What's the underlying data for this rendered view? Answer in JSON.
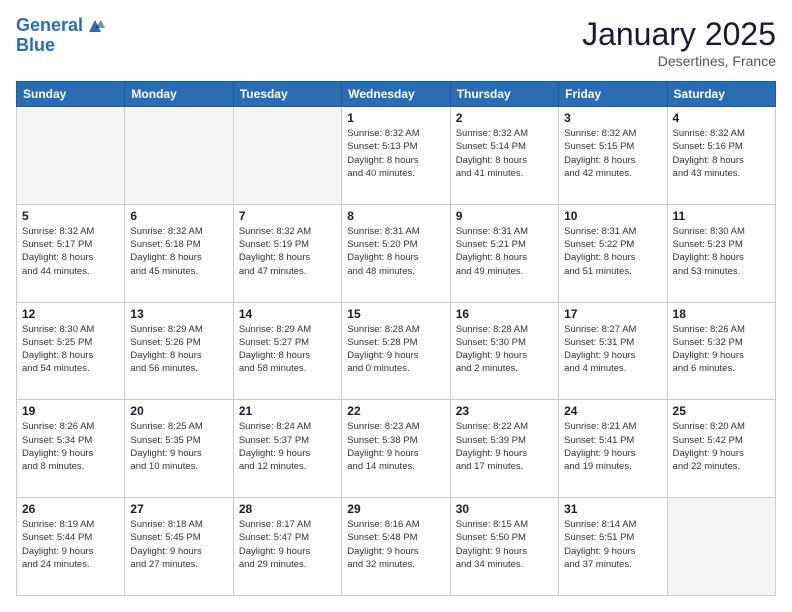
{
  "logo": {
    "line1": "General",
    "line2": "Blue"
  },
  "header": {
    "month": "January 2025",
    "location": "Desertines, France"
  },
  "days_of_week": [
    "Sunday",
    "Monday",
    "Tuesday",
    "Wednesday",
    "Thursday",
    "Friday",
    "Saturday"
  ],
  "weeks": [
    [
      {
        "day": "",
        "info": ""
      },
      {
        "day": "",
        "info": ""
      },
      {
        "day": "",
        "info": ""
      },
      {
        "day": "1",
        "info": "Sunrise: 8:32 AM\nSunset: 5:13 PM\nDaylight: 8 hours\nand 40 minutes."
      },
      {
        "day": "2",
        "info": "Sunrise: 8:32 AM\nSunset: 5:14 PM\nDaylight: 8 hours\nand 41 minutes."
      },
      {
        "day": "3",
        "info": "Sunrise: 8:32 AM\nSunset: 5:15 PM\nDaylight: 8 hours\nand 42 minutes."
      },
      {
        "day": "4",
        "info": "Sunrise: 8:32 AM\nSunset: 5:16 PM\nDaylight: 8 hours\nand 43 minutes."
      }
    ],
    [
      {
        "day": "5",
        "info": "Sunrise: 8:32 AM\nSunset: 5:17 PM\nDaylight: 8 hours\nand 44 minutes."
      },
      {
        "day": "6",
        "info": "Sunrise: 8:32 AM\nSunset: 5:18 PM\nDaylight: 8 hours\nand 45 minutes."
      },
      {
        "day": "7",
        "info": "Sunrise: 8:32 AM\nSunset: 5:19 PM\nDaylight: 8 hours\nand 47 minutes."
      },
      {
        "day": "8",
        "info": "Sunrise: 8:31 AM\nSunset: 5:20 PM\nDaylight: 8 hours\nand 48 minutes."
      },
      {
        "day": "9",
        "info": "Sunrise: 8:31 AM\nSunset: 5:21 PM\nDaylight: 8 hours\nand 49 minutes."
      },
      {
        "day": "10",
        "info": "Sunrise: 8:31 AM\nSunset: 5:22 PM\nDaylight: 8 hours\nand 51 minutes."
      },
      {
        "day": "11",
        "info": "Sunrise: 8:30 AM\nSunset: 5:23 PM\nDaylight: 8 hours\nand 53 minutes."
      }
    ],
    [
      {
        "day": "12",
        "info": "Sunrise: 8:30 AM\nSunset: 5:25 PM\nDaylight: 8 hours\nand 54 minutes."
      },
      {
        "day": "13",
        "info": "Sunrise: 8:29 AM\nSunset: 5:26 PM\nDaylight: 8 hours\nand 56 minutes."
      },
      {
        "day": "14",
        "info": "Sunrise: 8:29 AM\nSunset: 5:27 PM\nDaylight: 8 hours\nand 58 minutes."
      },
      {
        "day": "15",
        "info": "Sunrise: 8:28 AM\nSunset: 5:28 PM\nDaylight: 9 hours\nand 0 minutes."
      },
      {
        "day": "16",
        "info": "Sunrise: 8:28 AM\nSunset: 5:30 PM\nDaylight: 9 hours\nand 2 minutes."
      },
      {
        "day": "17",
        "info": "Sunrise: 8:27 AM\nSunset: 5:31 PM\nDaylight: 9 hours\nand 4 minutes."
      },
      {
        "day": "18",
        "info": "Sunrise: 8:26 AM\nSunset: 5:32 PM\nDaylight: 9 hours\nand 6 minutes."
      }
    ],
    [
      {
        "day": "19",
        "info": "Sunrise: 8:26 AM\nSunset: 5:34 PM\nDaylight: 9 hours\nand 8 minutes."
      },
      {
        "day": "20",
        "info": "Sunrise: 8:25 AM\nSunset: 5:35 PM\nDaylight: 9 hours\nand 10 minutes."
      },
      {
        "day": "21",
        "info": "Sunrise: 8:24 AM\nSunset: 5:37 PM\nDaylight: 9 hours\nand 12 minutes."
      },
      {
        "day": "22",
        "info": "Sunrise: 8:23 AM\nSunset: 5:38 PM\nDaylight: 9 hours\nand 14 minutes."
      },
      {
        "day": "23",
        "info": "Sunrise: 8:22 AM\nSunset: 5:39 PM\nDaylight: 9 hours\nand 17 minutes."
      },
      {
        "day": "24",
        "info": "Sunrise: 8:21 AM\nSunset: 5:41 PM\nDaylight: 9 hours\nand 19 minutes."
      },
      {
        "day": "25",
        "info": "Sunrise: 8:20 AM\nSunset: 5:42 PM\nDaylight: 9 hours\nand 22 minutes."
      }
    ],
    [
      {
        "day": "26",
        "info": "Sunrise: 8:19 AM\nSunset: 5:44 PM\nDaylight: 9 hours\nand 24 minutes."
      },
      {
        "day": "27",
        "info": "Sunrise: 8:18 AM\nSunset: 5:45 PM\nDaylight: 9 hours\nand 27 minutes."
      },
      {
        "day": "28",
        "info": "Sunrise: 8:17 AM\nSunset: 5:47 PM\nDaylight: 9 hours\nand 29 minutes."
      },
      {
        "day": "29",
        "info": "Sunrise: 8:16 AM\nSunset: 5:48 PM\nDaylight: 9 hours\nand 32 minutes."
      },
      {
        "day": "30",
        "info": "Sunrise: 8:15 AM\nSunset: 5:50 PM\nDaylight: 9 hours\nand 34 minutes."
      },
      {
        "day": "31",
        "info": "Sunrise: 8:14 AM\nSunset: 5:51 PM\nDaylight: 9 hours\nand 37 minutes."
      },
      {
        "day": "",
        "info": ""
      }
    ]
  ]
}
